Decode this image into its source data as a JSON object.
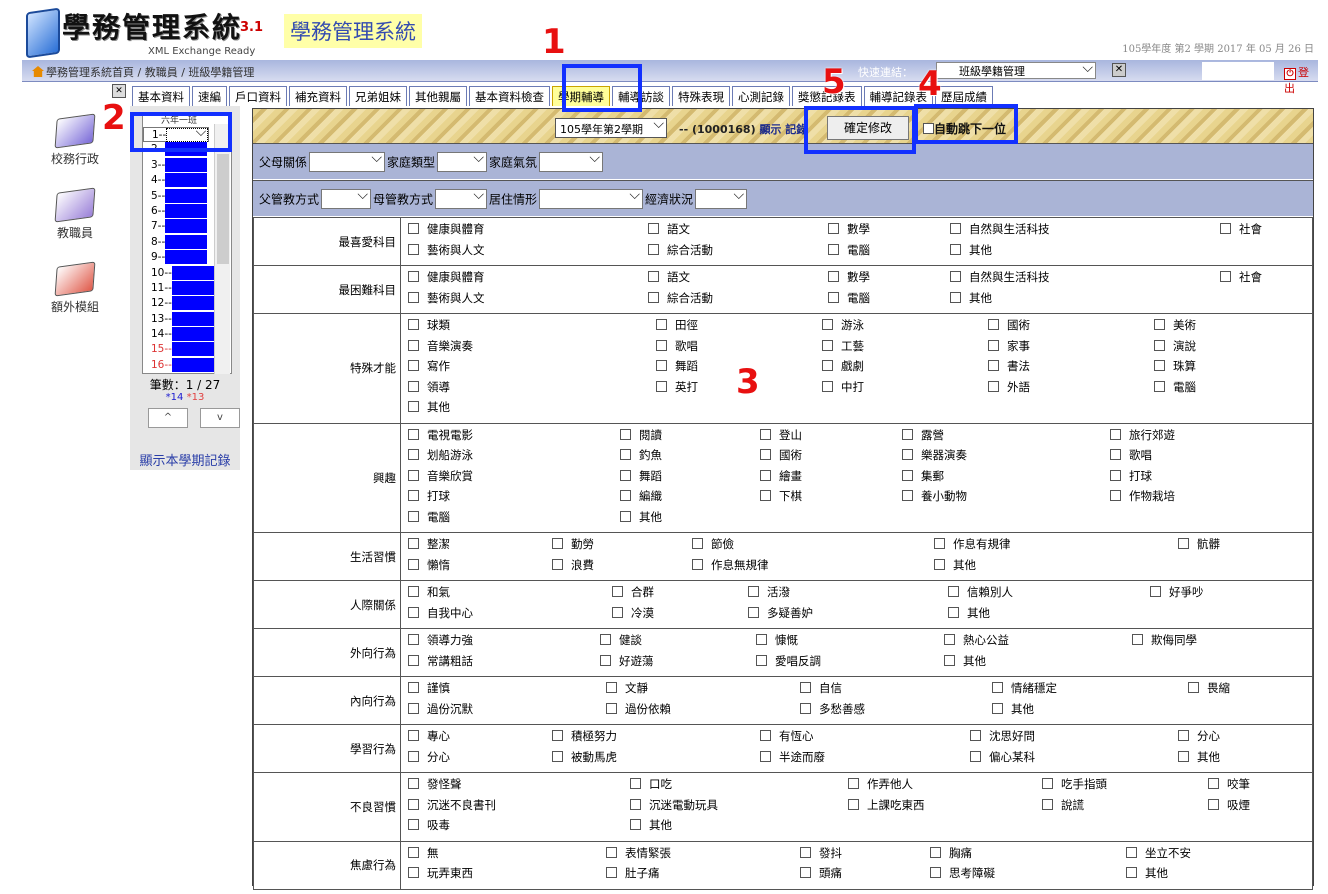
{
  "header": {
    "logo_title": "學務管理系統",
    "logo_version": "3.1",
    "logo_sub": "XML Exchange Ready",
    "app_title": "學務管理系統",
    "term_info": "105學年度 第2 學期 2017 年 05 月 26 日"
  },
  "navbar": {
    "breadcrumb": "學務管理系統首頁 / 教職員 / 班級學籍管理",
    "quick_link_label": "快速連結：",
    "quick_link_value": "班級學籍管理",
    "logout": "登出"
  },
  "tabs": [
    "基本資料",
    "速編",
    "戶口資料",
    "補充資料",
    "兄弟姐妹",
    "其他親屬",
    "基本資料檢查",
    "學期輔導",
    "輔導訪談",
    "特殊表現",
    "心測記錄",
    "獎懲記錄表",
    "輔導記錄表",
    "歷屆成績"
  ],
  "active_tab": "學期輔導",
  "sidebar": [
    {
      "label": "校務行政",
      "color": "#7a6ad8"
    },
    {
      "label": "教職員",
      "color": "#9a80d8"
    },
    {
      "label": "額外模組",
      "color": "#e05a4a"
    }
  ],
  "students": {
    "header": "六年一班",
    "rows": [
      "1--",
      "2--",
      "3--",
      "4--",
      "5--",
      "6--",
      "7--",
      "8--",
      "9--",
      "10--",
      "11--",
      "12--",
      "13--",
      "14--",
      "15--",
      "16--"
    ],
    "count": "筆數：1 / 27",
    "star_a": "*14",
    "star_b": "*13",
    "up": "^",
    "down": "v",
    "show_record": "顯示本學期記錄"
  },
  "topbar": {
    "term_select": "105學年第2學期",
    "student_id": "-- (1000168)",
    "show": "顯示",
    "record": "記錄",
    "confirm": "確定修改",
    "auto_next": "自動跳下一位"
  },
  "filters1": [
    "父母關係",
    "家庭類型",
    "家庭氣氛"
  ],
  "filters2": [
    "父管教方式",
    "母管教方式",
    "居住情形",
    "經濟狀況"
  ],
  "sections": [
    {
      "label": "最喜愛科目",
      "cols": [
        150,
        390,
        570,
        692,
        962
      ],
      "rows": [
        [
          "健康與體育",
          "語文",
          "數學",
          "自然與生活科技",
          "社會"
        ],
        [
          "藝術與人文",
          "綜合活動",
          "電腦",
          "其他"
        ]
      ]
    },
    {
      "label": "最困難科目",
      "cols": [
        150,
        390,
        570,
        692,
        962
      ],
      "rows": [
        [
          "健康與體育",
          "語文",
          "數學",
          "自然與生活科技",
          "社會"
        ],
        [
          "藝術與人文",
          "綜合活動",
          "電腦",
          "其他"
        ]
      ]
    },
    {
      "label": "特殊才能",
      "cols": [
        150,
        398,
        564,
        730,
        896
      ],
      "rows": [
        [
          "球類",
          "田徑",
          "游泳",
          "國術",
          "美術"
        ],
        [
          "音樂演奏",
          "歌唱",
          "工藝",
          "家事",
          "演說"
        ],
        [
          "寫作",
          "舞蹈",
          "戲劇",
          "書法",
          "珠算"
        ],
        [
          "領導",
          "英打",
          "中打",
          "外語",
          "電腦"
        ],
        [
          "其他"
        ]
      ]
    },
    {
      "label": "興趣",
      "cols": [
        150,
        362,
        502,
        644,
        852
      ],
      "rows": [
        [
          "電視電影",
          "閱讀",
          "登山",
          "露營",
          "旅行郊遊"
        ],
        [
          "划船游泳",
          "釣魚",
          "國術",
          "樂器演奏",
          "歌唱"
        ],
        [
          "音樂欣賞",
          "舞蹈",
          "繪畫",
          "集郵",
          "打球"
        ],
        [
          "打球",
          "編織",
          "下棋",
          "養小動物",
          "作物栽培"
        ],
        [
          "電腦",
          "其他"
        ]
      ]
    },
    {
      "label": "生活習慣",
      "cols": [
        150,
        294,
        434,
        676,
        920
      ],
      "rows": [
        [
          "整潔",
          "勤勞",
          "節儉",
          "作息有規律",
          "骯髒"
        ],
        [
          "懶惰",
          "浪費",
          "作息無規律",
          "其他"
        ]
      ]
    },
    {
      "label": "人際關係",
      "cols": [
        150,
        354,
        490,
        690,
        892
      ],
      "rows": [
        [
          "和氣",
          "合群",
          "活潑",
          "信賴別人",
          "好爭吵"
        ],
        [
          "自我中心",
          "冷漠",
          "多疑善妒",
          "其他"
        ]
      ]
    },
    {
      "label": "外向行為",
      "cols": [
        150,
        342,
        498,
        686,
        874
      ],
      "rows": [
        [
          "領導力強",
          "健談",
          "慷慨",
          "熱心公益",
          "欺侮同學"
        ],
        [
          "常講粗話",
          "好遊蕩",
          "愛唱反調",
          "其他"
        ]
      ]
    },
    {
      "label": "內向行為",
      "cols": [
        150,
        348,
        542,
        734,
        930
      ],
      "rows": [
        [
          "謹慎",
          "文靜",
          "自信",
          "情緒穩定",
          "畏縮"
        ],
        [
          "過份沉默",
          "過份依賴",
          "多愁善感",
          "其他"
        ]
      ]
    },
    {
      "label": "學習行為",
      "cols": [
        150,
        294,
        502,
        712,
        920
      ],
      "rows": [
        [
          "專心",
          "積極努力",
          "有恆心",
          "沈思好問",
          "分心"
        ],
        [
          "分心",
          "被動馬虎",
          "半途而廢",
          "偏心某科",
          "其他"
        ]
      ]
    },
    {
      "label": "不良習慣",
      "cols": [
        150,
        372,
        590,
        784,
        950
      ],
      "rows": [
        [
          "發怪聲",
          "口吃",
          "作弄他人",
          "吃手指頭",
          "咬筆"
        ],
        [
          "沉迷不良書刊",
          "沉迷電動玩具",
          "上課吃東西",
          "說謊",
          "吸煙"
        ],
        [
          "吸毒",
          "其他"
        ]
      ]
    },
    {
      "label": "焦慮行為",
      "cols": [
        150,
        348,
        542,
        672,
        868
      ],
      "rows": [
        [
          "無",
          "表情緊張",
          "發抖",
          "胸痛",
          "坐立不安"
        ],
        [
          "玩弄東西",
          "肚子痛",
          "頭痛",
          "思考障礙",
          "其他"
        ]
      ]
    }
  ],
  "annotations": [
    "1",
    "2",
    "3",
    "4",
    "5"
  ],
  "colors": {
    "annotation_box": "#1230ff",
    "annotation_number": "#e81010",
    "navbar": "#a9b6de",
    "filter_bar": "#aab4d6",
    "active_tab": "#ffff99"
  }
}
